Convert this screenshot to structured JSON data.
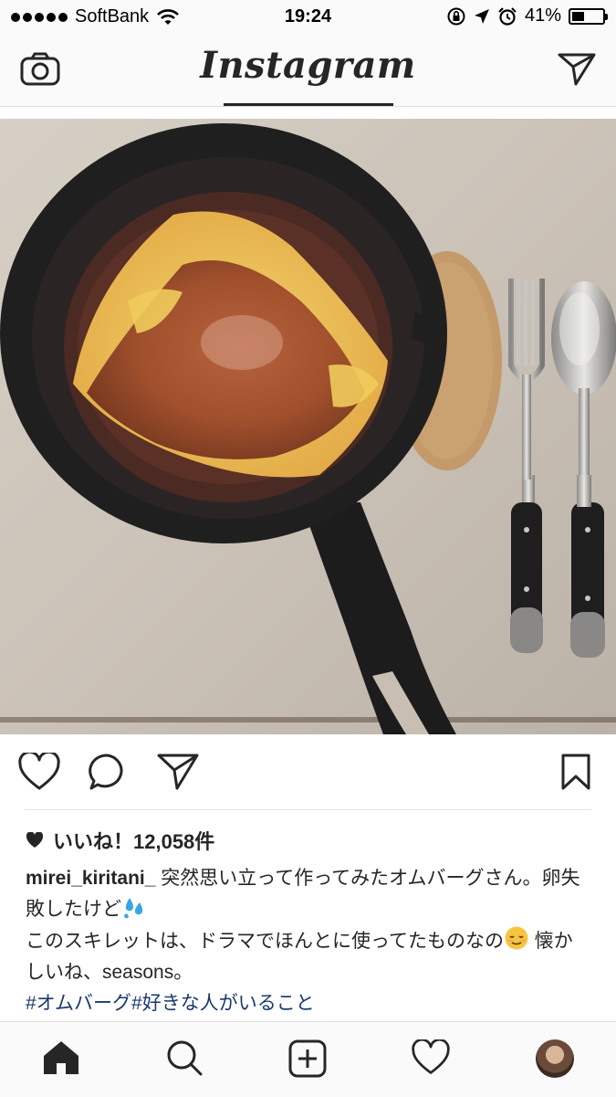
{
  "status_bar": {
    "carrier": "SoftBank",
    "time": "19:24",
    "battery_percent": "41%",
    "battery_level": 0.41
  },
  "nav": {
    "logo_text": "Instagram"
  },
  "post": {
    "likes_text": "いいね！12,058件",
    "username": "mirei_kiritani_",
    "caption_line1": " 突然思い立って作ってみたオムバーグさん。卵失敗したけど",
    "caption_line2": "このスキレットは、ドラマでほんとに使ってたものなの",
    "caption_line3": " 懐かしいね、seasons。",
    "hashtags": "#オムバーグ#好きな人がいること"
  },
  "icons": {
    "camera": "camera-icon",
    "direct": "paper-plane-icon",
    "like": "heart-icon",
    "comment": "comment-icon",
    "share": "paper-plane-icon",
    "save": "bookmark-icon",
    "home": "home-icon",
    "search": "search-icon",
    "add": "add-post-icon",
    "activity": "heart-icon",
    "profile": "avatar"
  }
}
